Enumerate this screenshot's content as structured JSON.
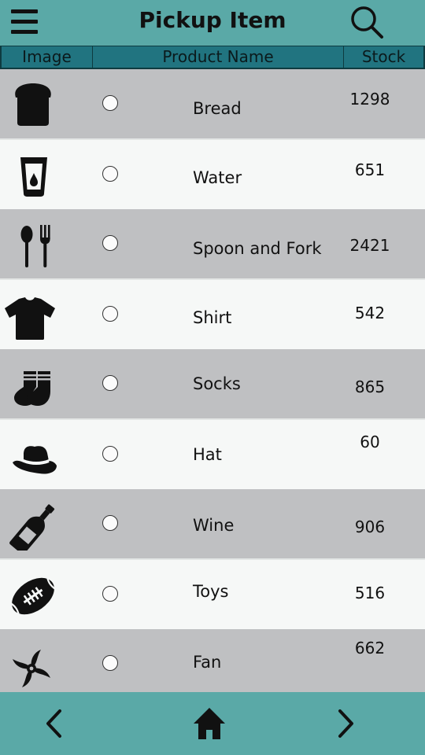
{
  "header": {
    "title": "Pickup Item",
    "menu_icon": "hamburger-menu-icon",
    "search_icon": "search-icon",
    "background": "#5aa9a7"
  },
  "columns": {
    "image": "Image",
    "product_name": "Product Name",
    "stock": "Stock",
    "background": "#217480"
  },
  "items": [
    {
      "icon": "bread-icon",
      "name": "Bread",
      "stock": "1298",
      "selected": false
    },
    {
      "icon": "water-glass-icon",
      "name": "Water",
      "stock": "651",
      "selected": false
    },
    {
      "icon": "spoon-fork-icon",
      "name": "Spoon and Fork",
      "stock": "2421",
      "selected": false
    },
    {
      "icon": "shirt-icon",
      "name": "Shirt",
      "stock": "542",
      "selected": false
    },
    {
      "icon": "socks-icon",
      "name": "Socks",
      "stock": "865",
      "selected": false
    },
    {
      "icon": "hat-icon",
      "name": "Hat",
      "stock": "60",
      "selected": false
    },
    {
      "icon": "wine-bottle-icon",
      "name": "Wine",
      "stock": "906",
      "selected": false
    },
    {
      "icon": "football-icon",
      "name": "Toys",
      "stock": "516",
      "selected": false
    },
    {
      "icon": "fan-icon",
      "name": "Fan",
      "stock": "662",
      "selected": false
    }
  ],
  "footer": {
    "back_icon": "chevron-left-icon",
    "home_icon": "home-icon",
    "forward_icon": "chevron-right-icon"
  },
  "colors": {
    "row_alt": "#bfc0c2",
    "row_base": "#f6f8f7"
  }
}
